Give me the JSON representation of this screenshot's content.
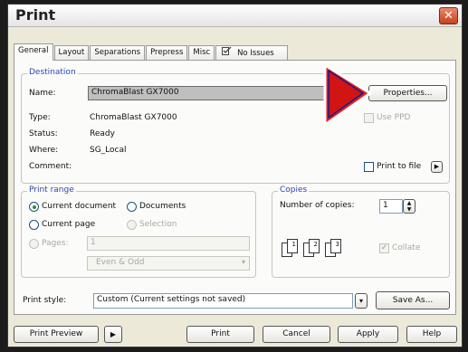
{
  "window": {
    "title": "Print"
  },
  "tabs": [
    {
      "label": "General",
      "active": true
    },
    {
      "label": "Layout",
      "active": false
    },
    {
      "label": "Separations",
      "active": false
    },
    {
      "label": "Prepress",
      "active": false
    },
    {
      "label": "Misc",
      "active": false
    },
    {
      "label": "No Issues",
      "active": false,
      "icon": "issues-check-icon"
    }
  ],
  "destination": {
    "legend": "Destination",
    "name_label": "Name:",
    "name_value": "ChromaBlast GX7000",
    "properties_label": "Properties...",
    "type_label": "Type:",
    "type_value": "ChromaBlast GX7000",
    "status_label": "Status:",
    "status_value": "Ready",
    "where_label": "Where:",
    "where_value": "SG_Local",
    "comment_label": "Comment:",
    "use_ppd_label": "Use PPD",
    "print_to_file_label": "Print to file"
  },
  "print_range": {
    "legend": "Print range",
    "current_document": "Current document",
    "documents": "Documents",
    "current_page": "Current page",
    "selection": "Selection",
    "pages": "Pages:",
    "pages_value": "1",
    "even_odd": "Even & Odd",
    "selected": "current_document"
  },
  "copies": {
    "legend": "Copies",
    "number_label": "Number of copies:",
    "number_value": "1",
    "collate_label": "Collate",
    "collate_checked": true
  },
  "print_style": {
    "label": "Print style:",
    "value": "Custom (Current settings not saved)",
    "save_as": "Save As..."
  },
  "buttons": {
    "print_preview": "Print Preview",
    "print": "Print",
    "cancel": "Cancel",
    "apply": "Apply",
    "help": "Help"
  },
  "colors": {
    "accent_red": "#e02020",
    "legend_blue": "#2c47b3",
    "close_button": "#c8401d"
  }
}
